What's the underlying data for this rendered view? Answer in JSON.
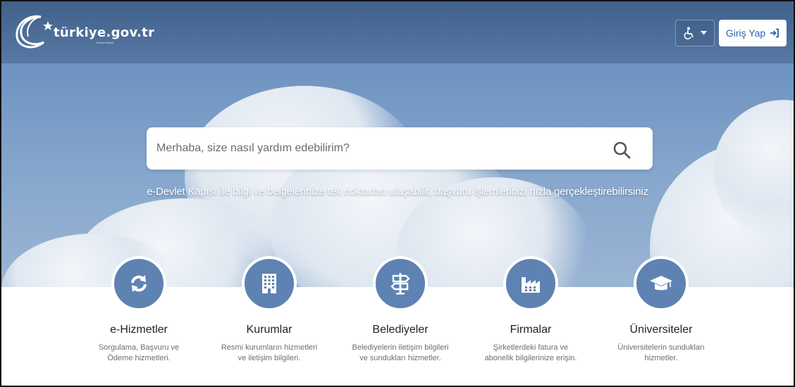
{
  "brand": {
    "name": "türkiye.gov.tr",
    "tagline_small": "\"Devlet Kapısı\""
  },
  "header": {
    "accessibility_label": "",
    "login_label": "Giriş Yap"
  },
  "search": {
    "placeholder": "Merhaba, size nasıl yardım edebilirim?"
  },
  "hero": {
    "tagline": "e-Devlet Kapısı ile bilgi ve belgelerinize tek noktadan ulaşabilir, başvuru işlemlerinizi hızla gerçekleştirebilirsiniz"
  },
  "categories": [
    {
      "title": "e-Hizmetler",
      "desc": "Sorgulama, Başvuru ve Ödeme hizmetleri.",
      "icon": "refresh-icon"
    },
    {
      "title": "Kurumlar",
      "desc": "Resmi kurumların hizmetleri ve iletişim bilgileri.",
      "icon": "building-icon"
    },
    {
      "title": "Belediyeler",
      "desc": "Belediyelerin iletişim bilgileri ve sundukları hizmetler.",
      "icon": "signpost-icon"
    },
    {
      "title": "Firmalar",
      "desc": "Şirketlerdeki fatura ve abonelik bilgilerinize erişin.",
      "icon": "factory-icon"
    },
    {
      "title": "Üniversiteler",
      "desc": "Üniversitelerin sundukları hizmetler.",
      "icon": "graduation-cap-icon"
    }
  ],
  "colors": {
    "accent": "#5e82b2",
    "login_text": "#2a63a6",
    "hero_top": "#5f86b6"
  }
}
